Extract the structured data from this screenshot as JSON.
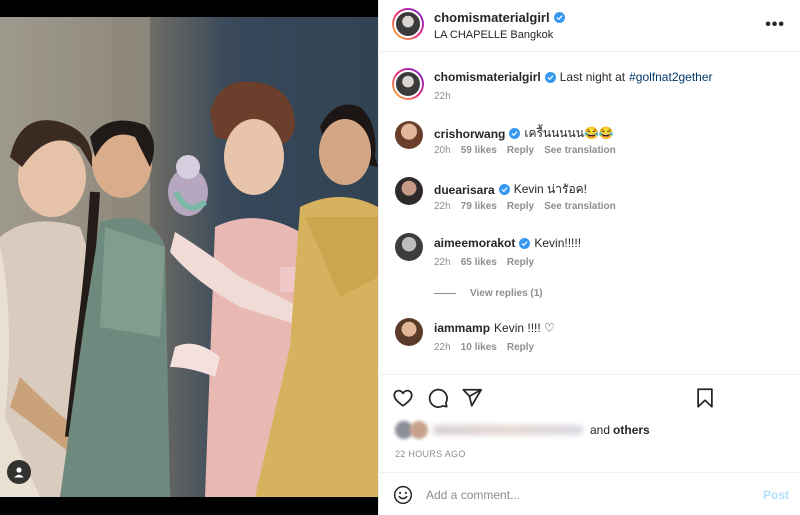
{
  "colors": {
    "accent": "#0095f6",
    "post_disabled": "#b2dffc",
    "verified": "#3897f0",
    "hashtag": "#00376b",
    "muted": "#8e8e8e"
  },
  "header": {
    "username": "chomismaterialgirl",
    "location": "LA CHAPELLE Bangkok",
    "more_icon": "more-horizontal-icon",
    "more_label": "•••"
  },
  "caption": {
    "username": "chomismaterialgirl",
    "text": "Last night at",
    "hashtag": "#golfnat2gether",
    "time": "22h"
  },
  "comments": [
    {
      "username": "crishorwang",
      "text": "เครื้นนนนน😂😂",
      "time": "20h",
      "likes": "59 likes",
      "reply": "Reply",
      "translate": "See translation"
    },
    {
      "username": "duearisara",
      "text": "Kevin น่ารัอค!",
      "time": "22h",
      "likes": "79 likes",
      "reply": "Reply",
      "translate": "See translation"
    },
    {
      "username": "aimeemorakot",
      "text": "Kevin!!!!!",
      "time": "22h",
      "likes": "65 likes",
      "reply": "Reply"
    },
    {
      "username": "iammamp",
      "text": "Kevin !!!! ♡",
      "time": "22h",
      "likes": "10 likes",
      "reply": "Reply"
    }
  ],
  "view_replies": "View replies (1)",
  "actions": [
    "heart-icon",
    "comment-icon",
    "share-icon",
    "bookmark-icon"
  ],
  "liked_by": {
    "connector": "and",
    "others": "others"
  },
  "posted_ago": "22 HOURS AGO",
  "add_comment": {
    "placeholder": "Add a comment...",
    "post_label": "Post",
    "emoji_icon": "emoji-icon"
  },
  "photo": {
    "user_tag_icon": "user-tag-icon"
  }
}
